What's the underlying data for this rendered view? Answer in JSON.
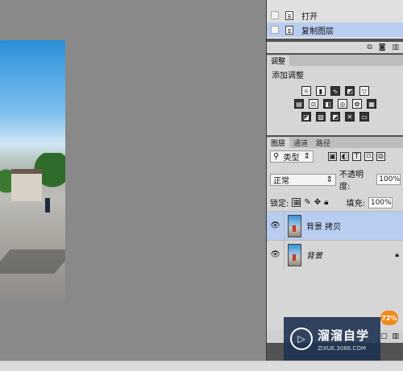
{
  "history": {
    "items": [
      {
        "label": "打开",
        "selected": false
      },
      {
        "label": "复制图层",
        "selected": true
      }
    ]
  },
  "adjustments": {
    "tab": "调整",
    "title": "添加调整",
    "row1": [
      "brightness-icon",
      "levels-icon",
      "curves-icon",
      "exposure-icon",
      "vibrance-icon"
    ],
    "row2": [
      "hue-saturation-icon",
      "color-balance-icon",
      "black-white-icon",
      "photo-filter-icon",
      "channel-mixer-icon",
      "color-lookup-icon"
    ],
    "row3": [
      "invert-icon",
      "posterize-icon",
      "threshold-icon",
      "selective-color-icon",
      "gradient-map-icon"
    ]
  },
  "layers": {
    "tabs": [
      "图层",
      "通道",
      "路径"
    ],
    "filter_label": "类型",
    "blend_mode": "正常",
    "opacity_label": "不透明度:",
    "opacity_value": "100%",
    "lock_label": "锁定:",
    "fill_label": "填充:",
    "fill_value": "100%",
    "items": [
      {
        "name": "背景 拷贝",
        "selected": true,
        "locked": false
      },
      {
        "name": "背景",
        "selected": false,
        "locked": true
      }
    ]
  },
  "watermark": {
    "title": "溜溜自学",
    "url": "ZIXUE.3066.COM"
  },
  "zoom_badge": "72%"
}
